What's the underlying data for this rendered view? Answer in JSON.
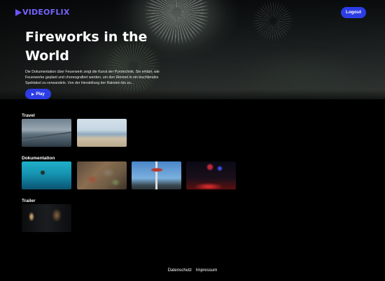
{
  "nav": {
    "logo_text": "VIDEOFLIX",
    "logout_label": "Logout"
  },
  "hero": {
    "title": "Fireworks in the World",
    "description": "Die Dokumentation über Feuerwerk zeigt die Kunst der Pyrotechnik. Sie erklärt, wie Feuerwerke geplant und choreografiert werden, um den Himmel in ein leuchtendes Spektakel zu verwandeln. Von der Herstellung der Raketen bis zu...",
    "play_label": "Play"
  },
  "sections": [
    {
      "title": "Travel",
      "videos": [
        {
          "icon": "pier-thumbnail"
        },
        {
          "icon": "beach-thumbnail"
        }
      ]
    },
    {
      "title": "Dokumentation",
      "videos": [
        {
          "icon": "diver-thumbnail"
        },
        {
          "icon": "leaves-thumbnail"
        },
        {
          "icon": "carousel-thumbnail"
        },
        {
          "icon": "fireworks-thumbnail"
        }
      ]
    },
    {
      "title": "Trailer",
      "videos": [
        {
          "icon": "trailer-thumbnail"
        }
      ]
    }
  ],
  "footer": {
    "links": [
      "Datenschutz",
      "Impressum"
    ]
  },
  "colors": {
    "accent": "#2c3de6",
    "logo": "#7463ff",
    "background": "#000000"
  }
}
